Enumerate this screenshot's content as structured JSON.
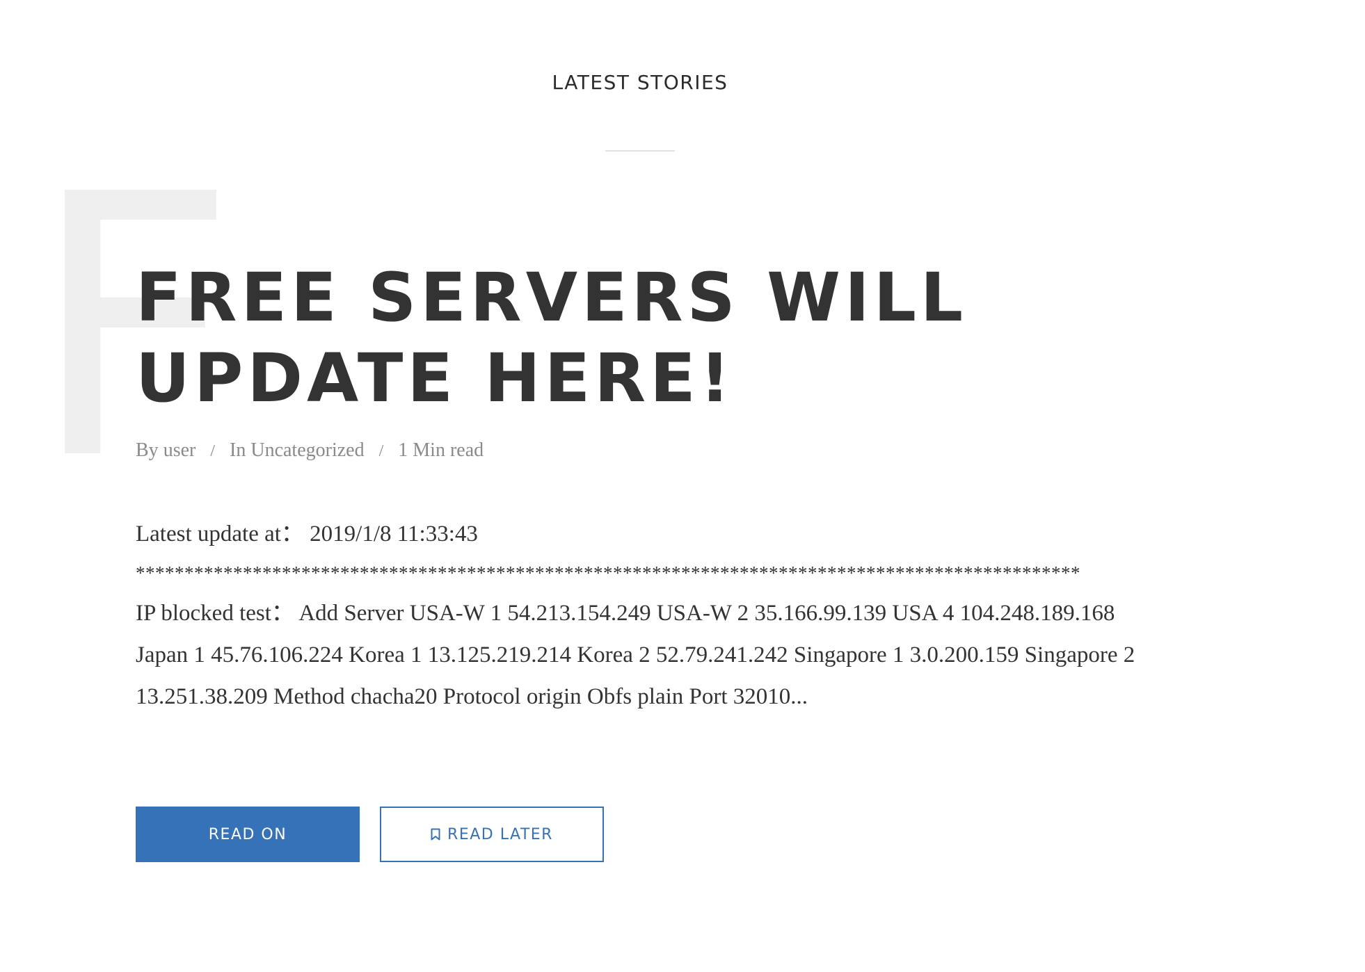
{
  "section": {
    "title": "LATEST STORIES"
  },
  "post": {
    "initial": "F",
    "title": "FREE SERVERS WILL UPDATE HERE!",
    "meta": {
      "author_prefix": "By",
      "author": "user",
      "category_prefix": "In",
      "category": "Uncategorized",
      "read_time": "1 Min read",
      "separator": "/"
    },
    "excerpt": {
      "update_line": "Latest update at：  2019/1/8 11:33:43",
      "stars": "*************************************************************************************************",
      "body": "IP blocked test：  Add Server USA-W 1 54.213.154.249 USA-W 2 35.166.99.139 USA 4 104.248.189.168 Japan 1 45.76.106.224 Korea 1 13.125.219.214 Korea 2 52.79.241.242 Singapore 1 3.0.200.159 Singapore 2 13.251.38.209 Method chacha20 Protocol origin Obfs plain Port 32010..."
    },
    "buttons": {
      "read_on": "READ ON",
      "read_later": "READ LATER",
      "read_later_icon": "bookmark-icon"
    }
  },
  "colors": {
    "accent": "#3672b8",
    "text": "#333333",
    "meta": "#8a8a8a",
    "watermark_letter": "#efefef"
  }
}
